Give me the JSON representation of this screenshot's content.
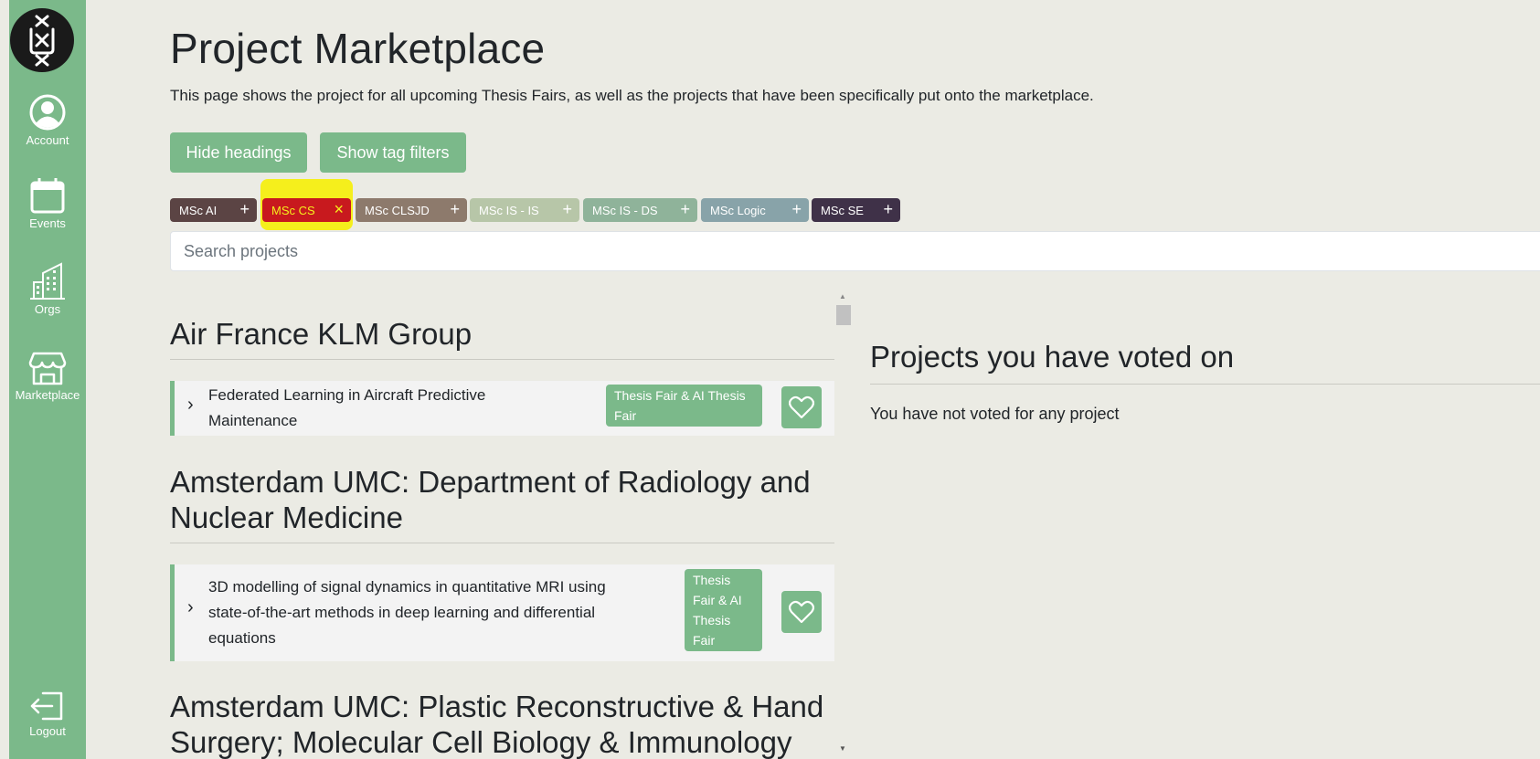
{
  "sidebar": {
    "logo_icon": "uva-logo-icon",
    "items": [
      {
        "label": "Account",
        "icon": "user-circle-icon"
      },
      {
        "label": "Events",
        "icon": "calendar-icon"
      },
      {
        "label": "Orgs",
        "icon": "building-icon"
      },
      {
        "label": "Marketplace",
        "icon": "store-icon"
      },
      {
        "label": "Logout",
        "icon": "logout-icon"
      }
    ]
  },
  "header": {
    "title": "Project Marketplace",
    "subtitle": "This page shows the project for all upcoming Thesis Fairs, as well as the projects that have been specifically put onto the marketplace."
  },
  "toolbar": {
    "hide_headings_label": "Hide headings",
    "show_tag_filters_label": "Show tag filters"
  },
  "tags": [
    {
      "label": "MSc AI",
      "icon": "plus-icon",
      "color": "#5b4444",
      "selected": false
    },
    {
      "label": "MSc CS",
      "icon": "close-icon",
      "color": "#c8191e",
      "selected": true
    },
    {
      "label": "MSc CLSJD",
      "icon": "plus-icon",
      "color": "#8d7a6c",
      "selected": false
    },
    {
      "label": "MSc IS - IS",
      "icon": "plus-icon",
      "color": "#b7c6a8",
      "selected": false
    },
    {
      "label": "MSc IS - DS",
      "icon": "plus-icon",
      "color": "#8fb39a",
      "selected": false
    },
    {
      "label": "MSc Logic",
      "icon": "plus-icon",
      "color": "#88a3a9",
      "selected": false
    },
    {
      "label": "MSc SE",
      "icon": "plus-icon",
      "color": "#3f3148",
      "selected": false
    }
  ],
  "search": {
    "placeholder": "Search projects",
    "value": ""
  },
  "organizations": [
    {
      "name": "Air France KLM Group",
      "projects": [
        {
          "title": "Federated Learning in Aircraft Predictive Maintenance",
          "badge": "Thesis Fair & AI Thesis Fair"
        }
      ]
    },
    {
      "name": "Amsterdam UMC: Department of Radiology and Nuclear Medicine",
      "projects": [
        {
          "title": "3D modelling of signal dynamics in quantitative MRI using state-of-the-art methods in deep learning and differential equations",
          "badge": "Thesis Fair & AI Thesis Fair"
        }
      ]
    },
    {
      "name": "Amsterdam UMC: Plastic Reconstructive & Hand Surgery; Molecular Cell Biology & Immunology",
      "projects": []
    }
  ],
  "voted": {
    "heading": "Projects you have voted on",
    "empty_text": "You have not voted for any project"
  },
  "colors": {
    "accent": "#7bb98a",
    "background": "#ebebe4",
    "highlight": "#f5ef1c"
  }
}
